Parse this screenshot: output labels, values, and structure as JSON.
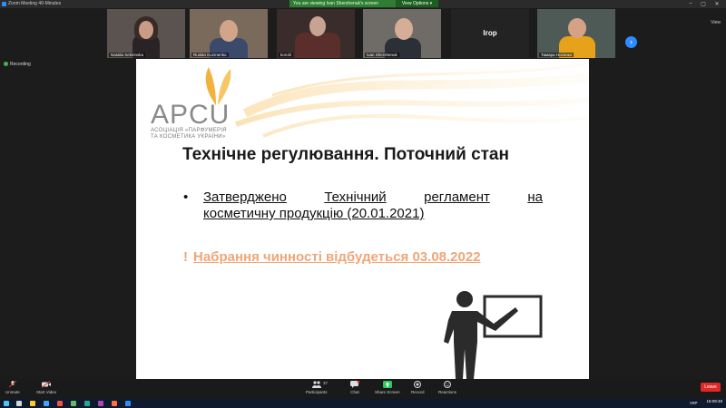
{
  "window": {
    "title": "Zoom Meeting 40-Minutes",
    "share_message": "You are viewing Ivan Shershenuk's screen",
    "view_options_label": "View Options",
    "view_label": "View"
  },
  "participants": [
    {
      "name": "Natalia Sekirinska"
    },
    {
      "name": "Ruslan Kuzmenko"
    },
    {
      "name": "korolir"
    },
    {
      "name": "Ivan Shershenuk"
    },
    {
      "name": "Ігор"
    },
    {
      "name": "Тамара Носенко"
    }
  ],
  "recording_label": "Recording",
  "slide": {
    "logo_text": "APCU",
    "logo_sub1": "АСОЦІАЦІЯ «ПАРФУМЕРІЯ",
    "logo_sub2": "ТА КОСМЕТИКА УКРАЇНИ»",
    "title": "Технічне регулювання. Поточний стан",
    "bullet_line1_words": [
      "Затверджено",
      "Технічний",
      "регламент",
      "на"
    ],
    "bullet_line2": "косметичну продукцію (20.01.2021)",
    "notice_mark": "!",
    "notice_text": "Набрання чинності відбудеться 03.08.2022",
    "colors": {
      "accent_orange": "#f0a577",
      "logo_gold": "#f2b33d"
    }
  },
  "toolbar": {
    "unmute": "Unmute",
    "start_video": "Start Video",
    "participants": "Participants",
    "participants_count": "37",
    "chat": "Chat",
    "share_screen": "Share Screen",
    "record": "Record",
    "reactions": "Reactions",
    "leave": "Leave"
  },
  "taskbar": {
    "lang": "УКР",
    "time": "16:09:48"
  }
}
